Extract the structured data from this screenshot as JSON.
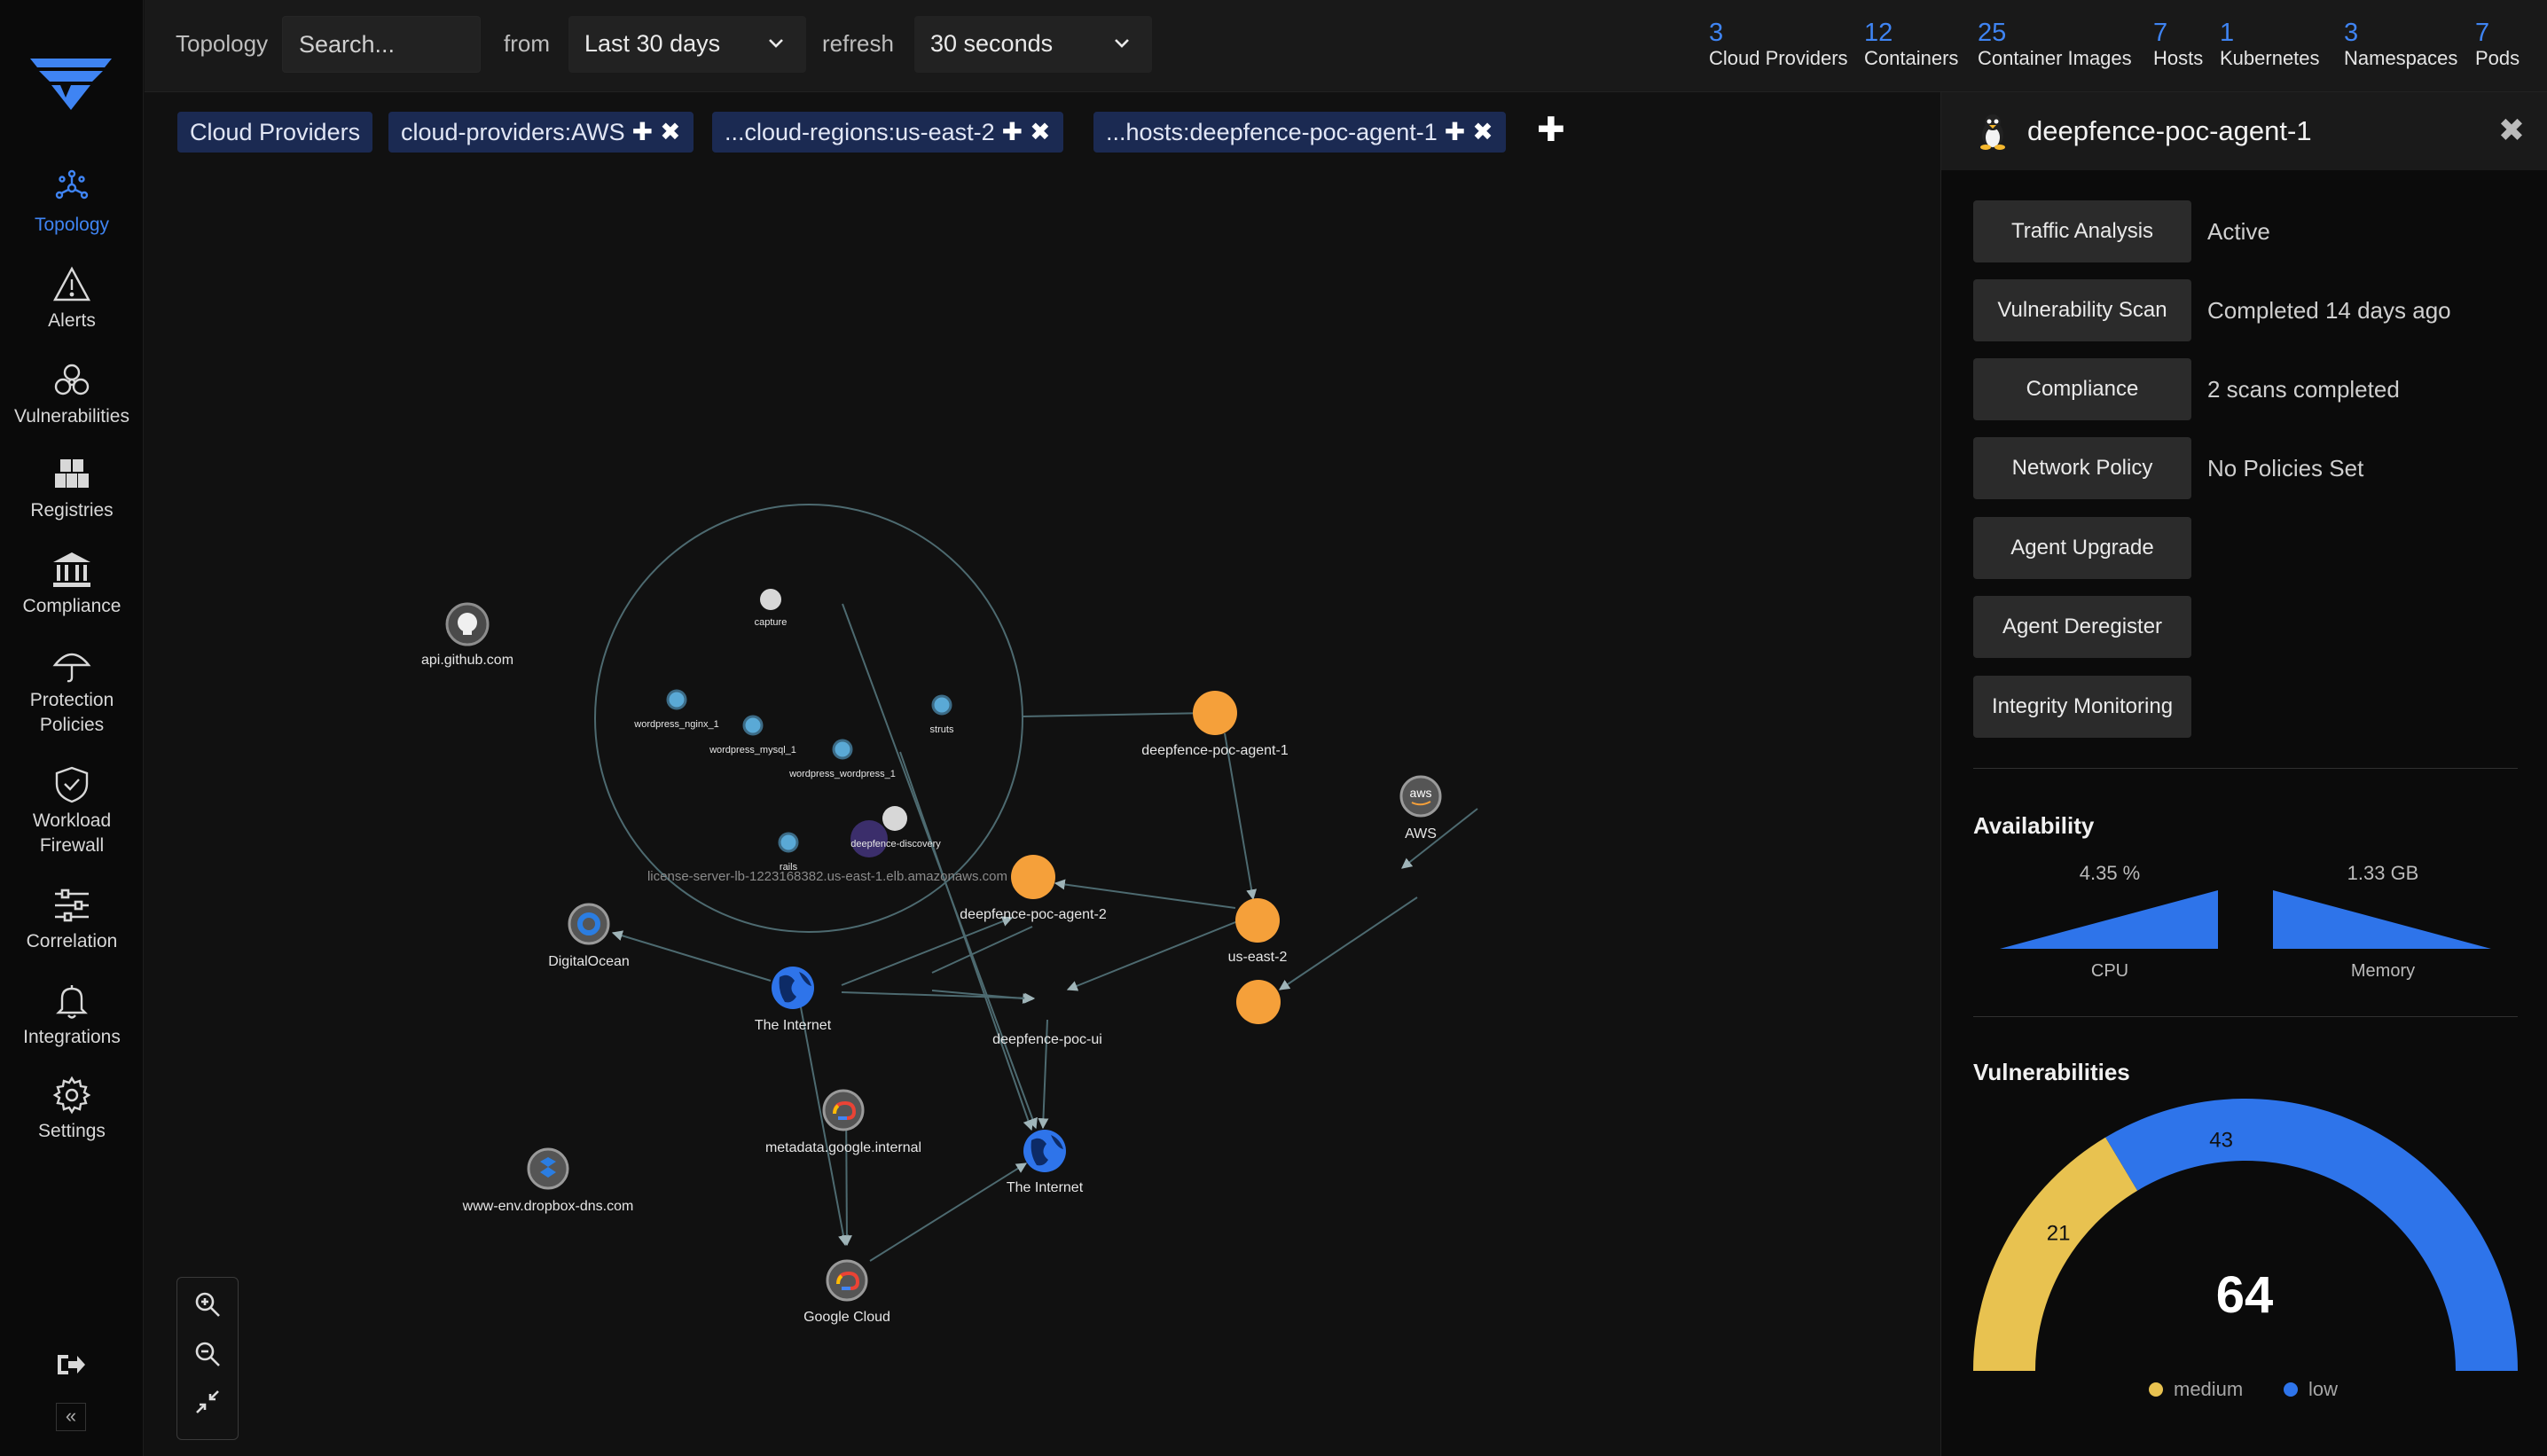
{
  "sidebar": {
    "items": [
      {
        "label": "Topology",
        "icon": "topology-icon",
        "active": true
      },
      {
        "label": "Alerts",
        "icon": "alert-triangle-icon"
      },
      {
        "label": "Vulnerabilities",
        "icon": "biohazard-icon"
      },
      {
        "label": "Registries",
        "icon": "boxes-icon"
      },
      {
        "label": "Compliance",
        "icon": "bank-icon"
      },
      {
        "label": "Protection Policies",
        "line1": "Protection",
        "line2": "Policies",
        "icon": "umbrella-icon"
      },
      {
        "label": "Workload Firewall",
        "line1": "Workload",
        "line2": "Firewall",
        "icon": "shield-check-icon"
      },
      {
        "label": "Correlation",
        "icon": "sliders-icon"
      },
      {
        "label": "Integrations",
        "icon": "bell-icon"
      },
      {
        "label": "Settings",
        "icon": "gear-icon"
      }
    ],
    "collapse_label": "«"
  },
  "topbar": {
    "section_label": "Topology",
    "search_placeholder": "Search...",
    "from_label": "from",
    "time_range": "Last 30 days",
    "refresh_label": "refresh",
    "refresh_interval": "30 seconds",
    "stats": [
      {
        "count": "3",
        "label": "Cloud Providers"
      },
      {
        "count": "12",
        "label": "Containers"
      },
      {
        "count": "25",
        "label": "Container Images"
      },
      {
        "count": "7",
        "label": "Hosts"
      },
      {
        "count": "1",
        "label": "Kubernetes"
      },
      {
        "count": "3",
        "label": "Namespaces"
      },
      {
        "count": "7",
        "label": "Pods"
      }
    ]
  },
  "filters": {
    "chips": [
      {
        "label": "Cloud Providers"
      },
      {
        "label": "cloud-providers:AWS",
        "add": "✚",
        "remove": "✖"
      },
      {
        "label": "...cloud-regions:us-east-2",
        "add": "✚",
        "remove": "✖"
      },
      {
        "label": "...hosts:deepfence-poc-agent-1",
        "add": "✚",
        "remove": "✖"
      }
    ],
    "add_label": "✚"
  },
  "graph": {
    "nodes": {
      "github": "api.github.com",
      "capture": "capture",
      "wp_nginx": "wordpress_nginx_1",
      "wp_mysql": "wordpress_mysql_1",
      "wp_wordpress": "wordpress_wordpress_1",
      "struts": "struts",
      "rails": "rails",
      "discovery": "deepfence-discovery",
      "license": "license-server-lb-1223168382.us-east-1.elb.amazonaws.com",
      "agent1": "deepfence-poc-agent-1",
      "agent2": "deepfence-poc-agent-2",
      "aws": "AWS",
      "aws_badge": "aws",
      "useast2": "us-east-2",
      "digitalocean": "DigitalOcean",
      "internet1": "The Internet",
      "pocui": "deepfence-poc-ui",
      "metadata": "metadata.google.internal",
      "internet2": "The Internet",
      "dropbox": "www-env.dropbox-dns.com",
      "gcloud": "Google Cloud"
    },
    "colors": {
      "host": "#f5a03a",
      "container": "#5aa9d6",
      "edge": "#4d6a70"
    }
  },
  "panel": {
    "title": "deepfence-poc-agent-1",
    "os_icon": "linux-penguin-icon",
    "close": "✖",
    "actions": [
      {
        "label": "Traffic Analysis",
        "value": "Active"
      },
      {
        "label": "Vulnerability Scan",
        "value": "Completed 14 days ago"
      },
      {
        "label": "Compliance",
        "value": "2 scans completed"
      },
      {
        "label": "Network Policy",
        "value": "No Policies Set"
      },
      {
        "label": "Agent Upgrade",
        "value": ""
      },
      {
        "label": "Agent Deregister",
        "value": ""
      },
      {
        "label": "Integrity Monitoring",
        "value": ""
      }
    ],
    "availability": {
      "title": "Availability",
      "cpu_value": "4.35 %",
      "cpu_label": "CPU",
      "memory_value": "1.33 GB",
      "memory_label": "Memory"
    },
    "vulnerabilities": {
      "title": "Vulnerabilities",
      "total": "64",
      "medium": 21,
      "low": 43,
      "medium_label": "medium",
      "low_label": "low",
      "medium_color": "#e8c250",
      "low_color": "#2e74ea"
    }
  }
}
